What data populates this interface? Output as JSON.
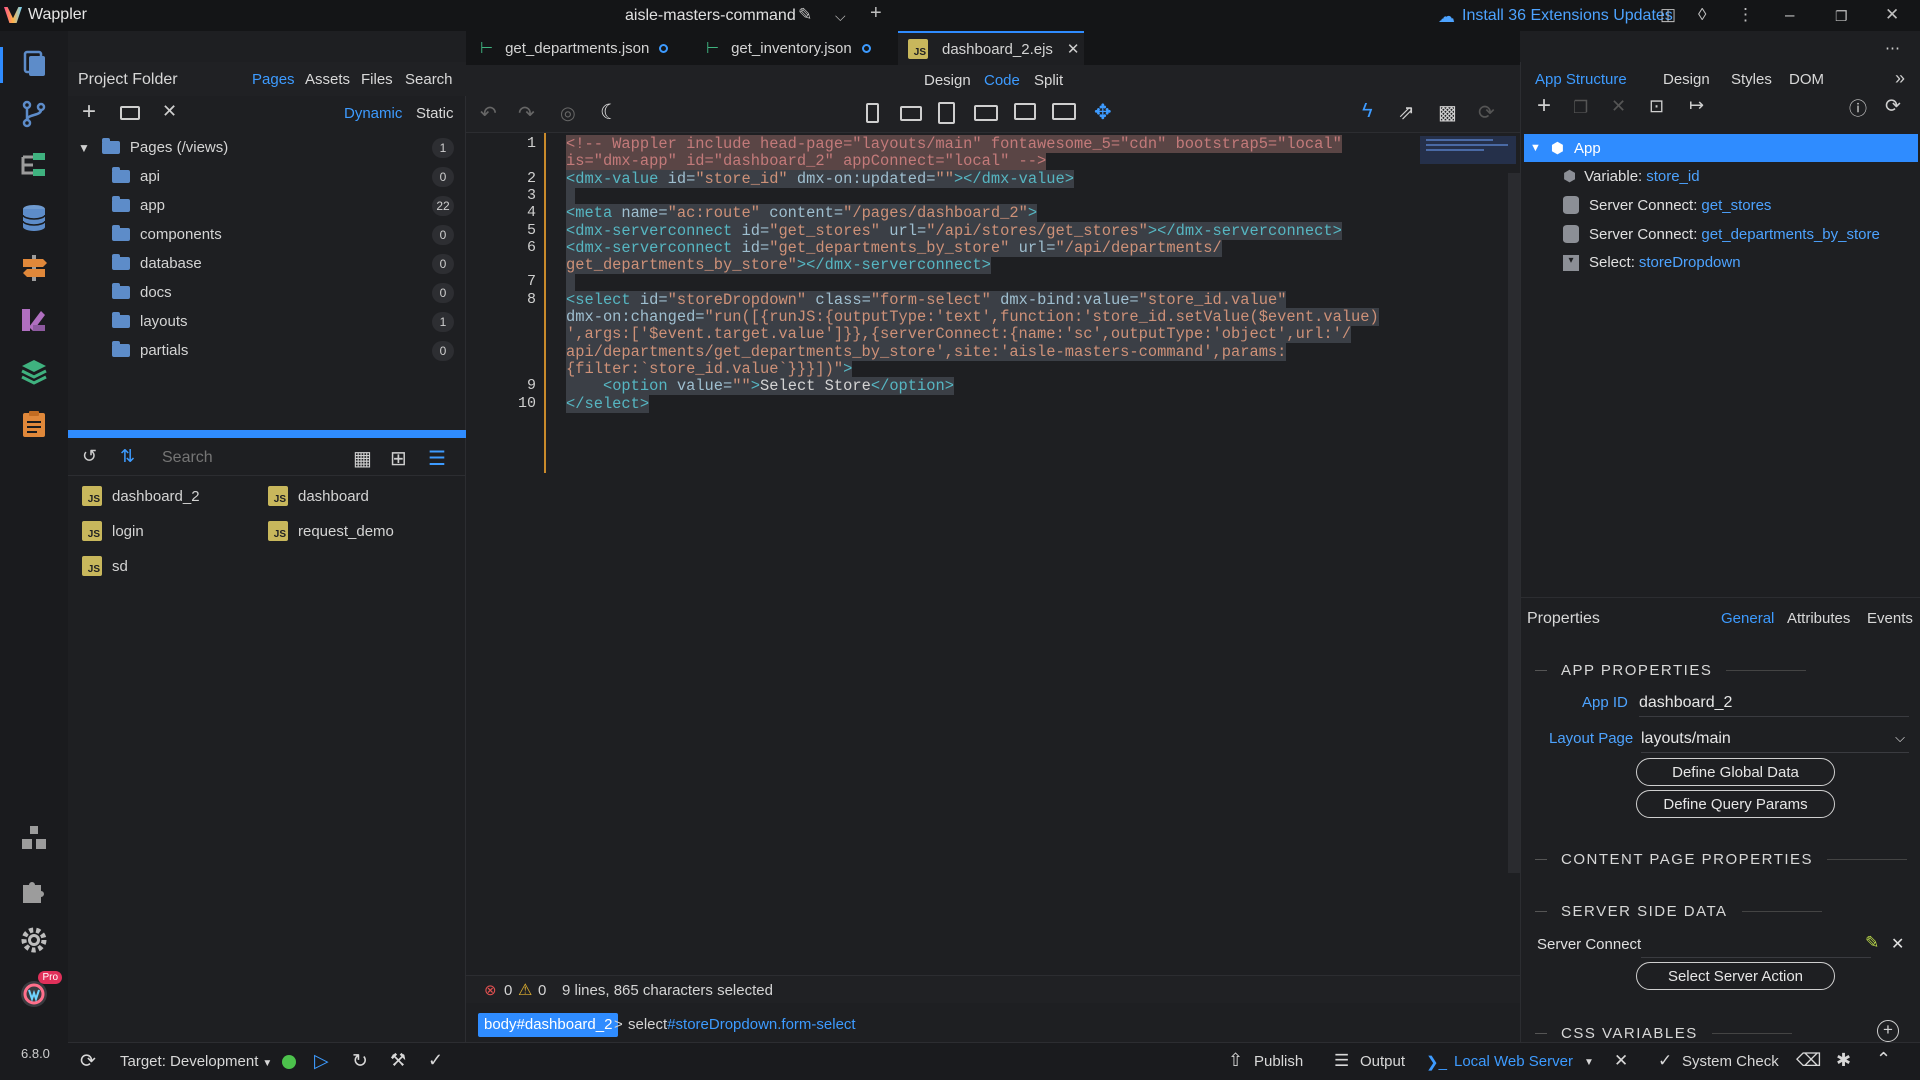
{
  "app": {
    "name": "Wappler",
    "project": "aisle-masters-command",
    "version": "6.8.0",
    "pro_badge": "Pro"
  },
  "titlebar": {
    "updates": "Install 36 Extensions Updates"
  },
  "left_panel": {
    "title": "Project Folder",
    "tabs": [
      "Pages",
      "Assets",
      "Files",
      "Search"
    ],
    "modes": [
      "Dynamic",
      "Static"
    ],
    "tree_root": {
      "label": "Pages (/views)",
      "count": "1"
    },
    "folders": [
      {
        "name": "api",
        "count": "0"
      },
      {
        "name": "app",
        "count": "22"
      },
      {
        "name": "components",
        "count": "0"
      },
      {
        "name": "database",
        "count": "0"
      },
      {
        "name": "docs",
        "count": "0"
      },
      {
        "name": "layouts",
        "count": "1"
      },
      {
        "name": "partials",
        "count": "0"
      }
    ],
    "search_placeholder": "Search",
    "files": [
      {
        "name": "dashboard_2",
        "badge": "JS"
      },
      {
        "name": "dashboard",
        "badge": "JS"
      },
      {
        "name": "login",
        "badge": "JS"
      },
      {
        "name": "request_demo",
        "badge": "JS"
      },
      {
        "name": "sd",
        "badge": "JS"
      }
    ]
  },
  "tabs": [
    {
      "label": "get_departments.json",
      "modified": true
    },
    {
      "label": "get_inventory.json",
      "modified": true
    },
    {
      "label": "dashboard_2.ejs",
      "active": true
    }
  ],
  "view_modes": [
    "Design",
    "Code",
    "Split"
  ],
  "editor": {
    "lines": [
      {
        "n": "1",
        "segments": [
          [
            "cm",
            "<!-- Wappler include head-page=\"layouts/main\" fontawesome_5=\"cdn\" bootstrap5=\"local\""
          ]
        ]
      },
      {
        "n": "",
        "segments": [
          [
            "cm",
            "is=\"dmx-app\" id=\"dashboard_2\" appConnect=\"local\" -->"
          ]
        ]
      },
      {
        "n": "2",
        "segments": [
          [
            "tg",
            "<dmx-value"
          ],
          [
            "at",
            " id="
          ],
          [
            "st",
            "\"store_id\""
          ],
          [
            "at",
            " dmx-on:updated="
          ],
          [
            "st",
            "\"\""
          ],
          [
            "tg",
            "></dmx-value>"
          ]
        ]
      },
      {
        "n": "3",
        "segments": [
          [
            "",
            " "
          ]
        ]
      },
      {
        "n": "4",
        "segments": [
          [
            "tg",
            "<meta"
          ],
          [
            "at",
            " name="
          ],
          [
            "st",
            "\"ac:route\""
          ],
          [
            "at",
            " content="
          ],
          [
            "st",
            "\"/pages/dashboard_2\""
          ],
          [
            "tg",
            ">"
          ]
        ]
      },
      {
        "n": "5",
        "segments": [
          [
            "tg",
            "<dmx-serverconnect"
          ],
          [
            "at",
            " id="
          ],
          [
            "st",
            "\"get_stores\""
          ],
          [
            "at",
            " url="
          ],
          [
            "st",
            "\"/api/stores/get_stores\""
          ],
          [
            "tg",
            "></dmx-serverconnect>"
          ]
        ]
      },
      {
        "n": "6",
        "segments": [
          [
            "tg",
            "<dmx-serverconnect"
          ],
          [
            "at",
            " id="
          ],
          [
            "st",
            "\"get_departments_by_store\""
          ],
          [
            "at",
            " url="
          ],
          [
            "st",
            "\"/api/departments/"
          ]
        ]
      },
      {
        "n": "",
        "segments": [
          [
            "st",
            "get_departments_by_store\""
          ],
          [
            "tg",
            "></dmx-serverconnect>"
          ]
        ]
      },
      {
        "n": "7",
        "segments": [
          [
            "",
            " "
          ]
        ]
      },
      {
        "n": "8",
        "segments": [
          [
            "tg",
            "<select"
          ],
          [
            "at",
            " id="
          ],
          [
            "st",
            "\"storeDropdown\""
          ],
          [
            "at",
            " class="
          ],
          [
            "st",
            "\"form-select\""
          ],
          [
            "at",
            " dmx-bind:value="
          ],
          [
            "st",
            "\"store_id.value\""
          ]
        ]
      },
      {
        "n": "",
        "segments": [
          [
            "at",
            "dmx-on:changed="
          ],
          [
            "st",
            "\"run([{runJS:{outputType:'text',function:'store_id.setValue($event.value)"
          ]
        ]
      },
      {
        "n": "",
        "segments": [
          [
            "st",
            "',args:['$event.target.value']}},{serverConnect:{name:'sc',outputType:'object',url:'/"
          ]
        ]
      },
      {
        "n": "",
        "segments": [
          [
            "st",
            "api/departments/get_departments_by_store',site:'aisle-masters-command',params:"
          ]
        ]
      },
      {
        "n": "",
        "segments": [
          [
            "st",
            "{filter:`store_id.value`}}}])\""
          ],
          [
            "tg",
            ">"
          ]
        ]
      },
      {
        "n": "9",
        "segments": [
          [
            "",
            "    "
          ],
          [
            "tg",
            "<option"
          ],
          [
            "at",
            " value="
          ],
          [
            "st",
            "\"\""
          ],
          [
            "tg",
            ">"
          ],
          [
            "",
            "Select Store"
          ],
          [
            "tg",
            "</option>"
          ]
        ]
      },
      {
        "n": "10",
        "segments": [
          [
            "tg",
            "</select>"
          ]
        ]
      }
    ]
  },
  "status": {
    "errors": "0",
    "warnings": "0",
    "selection": "9 lines, 865 characters selected"
  },
  "breadcrumb": {
    "body": "body#dashboard_2",
    "sep": ">",
    "select_tag": "select",
    "select_rest": "#storeDropdown.form-select"
  },
  "right_panel": {
    "tabs": [
      "App Structure",
      "Design",
      "Styles",
      "DOM"
    ],
    "root": "App",
    "nodes": [
      {
        "type": "Variable:",
        "name": "store_id"
      },
      {
        "type": "Server Connect:",
        "name": "get_stores"
      },
      {
        "type": "Server Connect:",
        "name": "get_departments_by_store"
      },
      {
        "type": "Select:",
        "name": "storeDropdown"
      }
    ],
    "properties": {
      "title": "Properties",
      "tabs": [
        "General",
        "Attributes",
        "Events"
      ],
      "app_section": "APP PROPERTIES",
      "app_id_label": "App ID",
      "app_id": "dashboard_2",
      "layout_label": "Layout Page",
      "layout": "layouts/main",
      "btn_global": "Define Global Data",
      "btn_query": "Define Query Params",
      "content_section": "CONTENT PAGE PROPERTIES",
      "server_section": "SERVER SIDE DATA",
      "server_connect_label": "Server Connect",
      "btn_server_action": "Select Server Action",
      "css_section": "CSS VARIABLES"
    }
  },
  "bottom": {
    "target": "Target:  Development",
    "publish": "Publish",
    "output": "Output",
    "local_server": "Local Web Server",
    "system_check": "System Check"
  },
  "colors": {
    "accent": "#2f8cff",
    "link": "#3d9bff",
    "modified_gutter": "#c98a2b",
    "server_ok": "#4cc24c"
  }
}
